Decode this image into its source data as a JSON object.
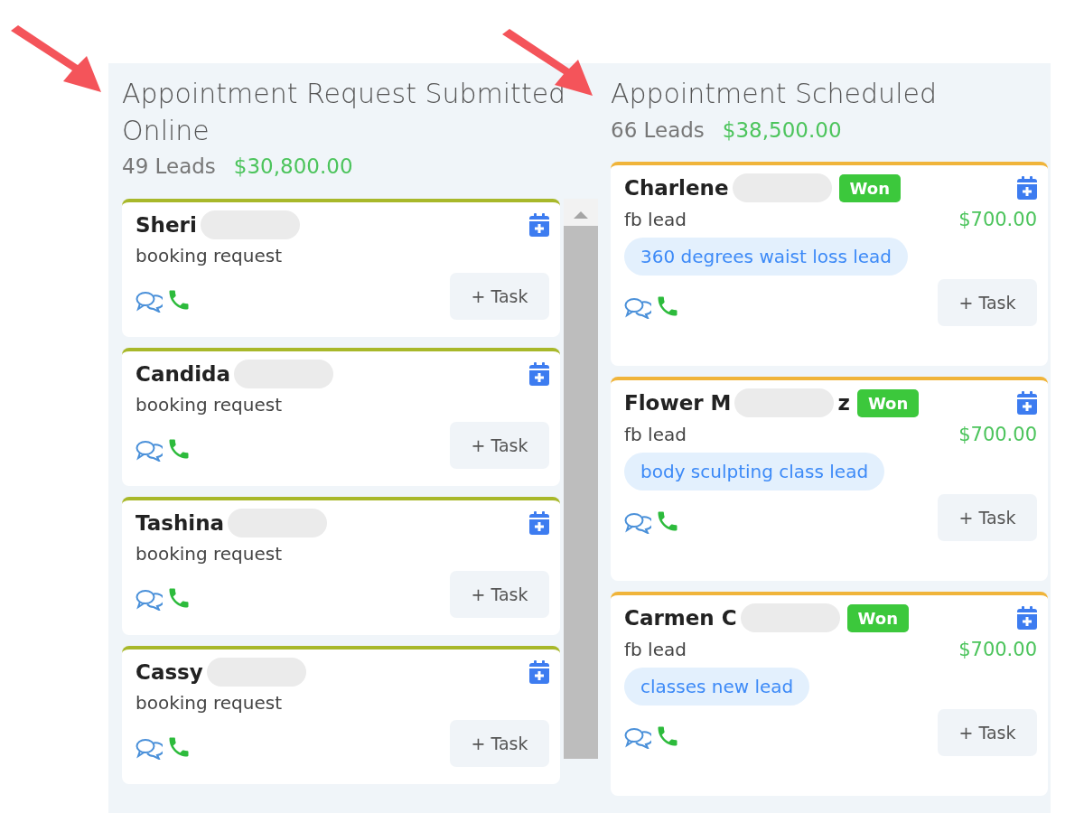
{
  "columns": [
    {
      "title": "Appointment Request Submitted Online",
      "lead_count": "49 Leads",
      "amount": "$30,800.00",
      "scrollbar": true,
      "color": "#a8b82a",
      "cards": [
        {
          "name": "Sheri",
          "source": "booking request",
          "task_button": "+ Task"
        },
        {
          "name": "Candida",
          "source": "booking request",
          "task_button": "+ Task"
        },
        {
          "name": "Tashina",
          "source": "booking request",
          "task_button": "+ Task"
        },
        {
          "name": "Cassy",
          "source": "booking request",
          "task_button": "+ Task"
        }
      ]
    },
    {
      "title": "Appointment Scheduled",
      "lead_count": "66 Leads",
      "amount": "$38,500.00",
      "scrollbar": false,
      "color": "#f0b43a",
      "cards": [
        {
          "name": "Charlene",
          "badge": "Won",
          "source": "fb lead",
          "value": "$700.00",
          "tag": "360 degrees waist loss lead",
          "task_button": "+ Task"
        },
        {
          "name": "Flower M",
          "name_tail": "z",
          "badge": "Won",
          "source": "fb lead",
          "value": "$700.00",
          "tag": "body sculpting class lead",
          "task_button": "+ Task"
        },
        {
          "name": "Carmen C",
          "badge": "Won",
          "source": "fb lead",
          "value": "$700.00",
          "tag": "classes new lead",
          "task_button": "+ Task"
        }
      ]
    }
  ]
}
